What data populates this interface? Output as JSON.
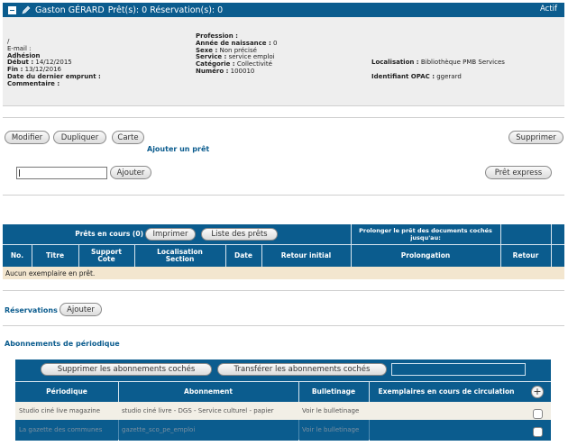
{
  "header": {
    "name": "Gaston GÉRARD",
    "counts": "Prêt(s): 0 Réservation(s): 0",
    "status": "Actif"
  },
  "info": {
    "col1": {
      "slash": "/",
      "email": "E-mail :",
      "adhesion_label": "Adhésion",
      "debut_label": "Début :",
      "debut_value": "14/12/2015",
      "fin_label": "Fin :",
      "fin_value": "13/12/2016",
      "dernier_emprunt": "Date du dernier emprunt :",
      "commentaire": "Commentaire :"
    },
    "col2": {
      "profession": "Profession :",
      "naissance_label": "Année de naissance :",
      "naissance_value": "0",
      "sexe_label": "Sexe :",
      "sexe_value": "Non précisé",
      "service_label": "Service :",
      "service_value": "service emploi",
      "categorie_label": "Catégorie :",
      "categorie_value": "Collectivité",
      "numero_label": "Numéro :",
      "numero_value": "100010"
    },
    "col3": {
      "localisation_label": "Localisation :",
      "localisation_value": "Bibliothèque PMB Services",
      "opac_label": "Identifiant OPAC :",
      "opac_value": "ggerard"
    }
  },
  "actions": {
    "modifier": "Modifier",
    "dupliquer": "Dupliquer",
    "carte": "Carte",
    "supprimer": "Supprimer",
    "ajouter_pret": "Ajouter un prêt",
    "ajouter": "Ajouter",
    "pret_express": "Prêt express"
  },
  "prets": {
    "title": "Prêts en cours  (0)",
    "imprimer": "Imprimer",
    "liste": "Liste des prêts",
    "prolonger": "Prolonger le prêt des documents cochés jusqu'au:",
    "columns": [
      "No.",
      "Titre",
      "Support Cote",
      "Localisation Section",
      "Date",
      "Retour initial",
      "Prolongation",
      "Retour"
    ],
    "empty": "Aucun exemplaire en prêt."
  },
  "reservations": {
    "label": "Réservations",
    "ajouter": "Ajouter"
  },
  "abonnements": {
    "title": "Abonnements de périodique",
    "supprimer": "Supprimer les abonnements cochés",
    "transferer": "Transférer les abonnements cochés",
    "columns": [
      "Périodique",
      "Abonnement",
      "Bulletinage",
      "Exemplaires en cours de circulation"
    ],
    "rows": [
      {
        "periodique": "Studio ciné live magazine",
        "abonnement": "studio ciné livre - DGS - Service culturel - papier",
        "bulletinage": "Voir le bulletinage"
      },
      {
        "periodique": "La gazette des communes",
        "abonnement": "gazette_sco_pe_emploi",
        "bulletinage": "Voir le bulletinage"
      }
    ]
  }
}
